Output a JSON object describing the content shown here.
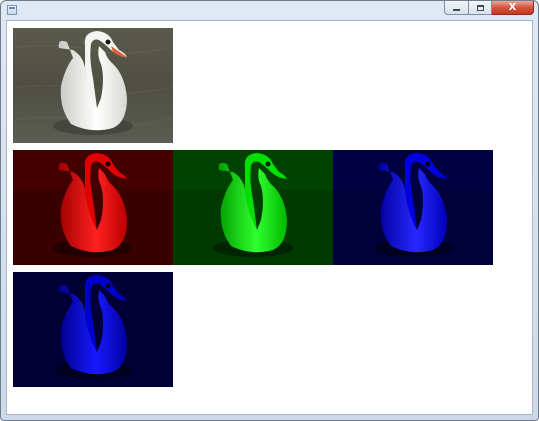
{
  "window": {
    "title": "",
    "controls": {
      "minimize_icon": "minimize-icon",
      "maximize_icon": "maximize-icon",
      "close_label": "X"
    }
  },
  "images": [
    {
      "name": "swan-original",
      "tint": "original"
    },
    {
      "name": "swan-red-channel",
      "tint": "#ff0000"
    },
    {
      "name": "swan-green-channel",
      "tint": "#00ff00"
    },
    {
      "name": "swan-blue-channel",
      "tint": "#0000ff"
    },
    {
      "name": "swan-blue-dark",
      "tint": "#0000ff"
    }
  ],
  "colors": {
    "frame": "#d3e0ef",
    "close_button": "#d6543c"
  }
}
